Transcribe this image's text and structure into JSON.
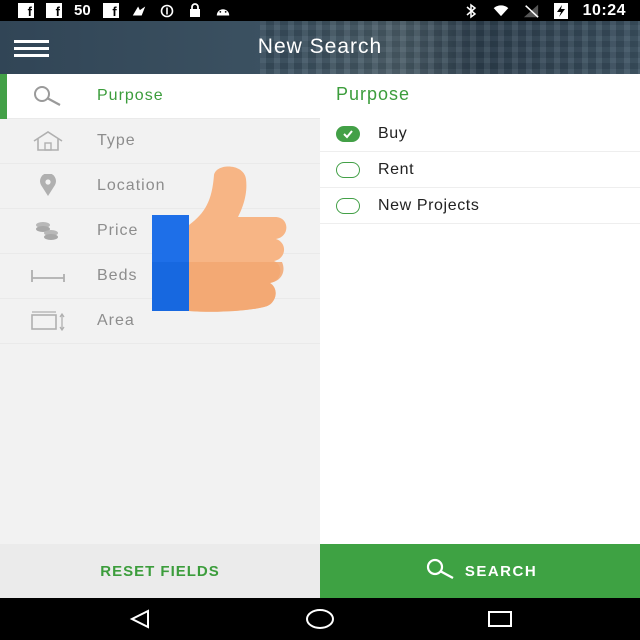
{
  "status_bar": {
    "fb_icon": "facebook-icon",
    "signal_text": "50",
    "time": "10:24"
  },
  "header": {
    "title": "New Search",
    "menu_icon": "hamburger-menu-icon"
  },
  "sidebar": {
    "items": [
      {
        "label": "Purpose",
        "icon": "search-icon",
        "active": true
      },
      {
        "label": "Type",
        "icon": "house-icon",
        "active": false
      },
      {
        "label": "Location",
        "icon": "location-pin-icon",
        "active": false
      },
      {
        "label": "Price",
        "icon": "coins-icon",
        "active": false
      },
      {
        "label": "Beds",
        "icon": "bed-icon",
        "active": false
      },
      {
        "label": "Area",
        "icon": "area-icon",
        "active": false
      }
    ]
  },
  "panel": {
    "title": "Purpose",
    "options": [
      {
        "label": "Buy",
        "selected": true
      },
      {
        "label": "Rent",
        "selected": false
      },
      {
        "label": "New Projects",
        "selected": false
      }
    ]
  },
  "footer": {
    "reset_label": "RESET FIELDS",
    "search_label": "SEARCH"
  },
  "colors": {
    "accent": "#43a047",
    "header": "#3c5262",
    "sidebar_bg": "#f2f2f2"
  }
}
